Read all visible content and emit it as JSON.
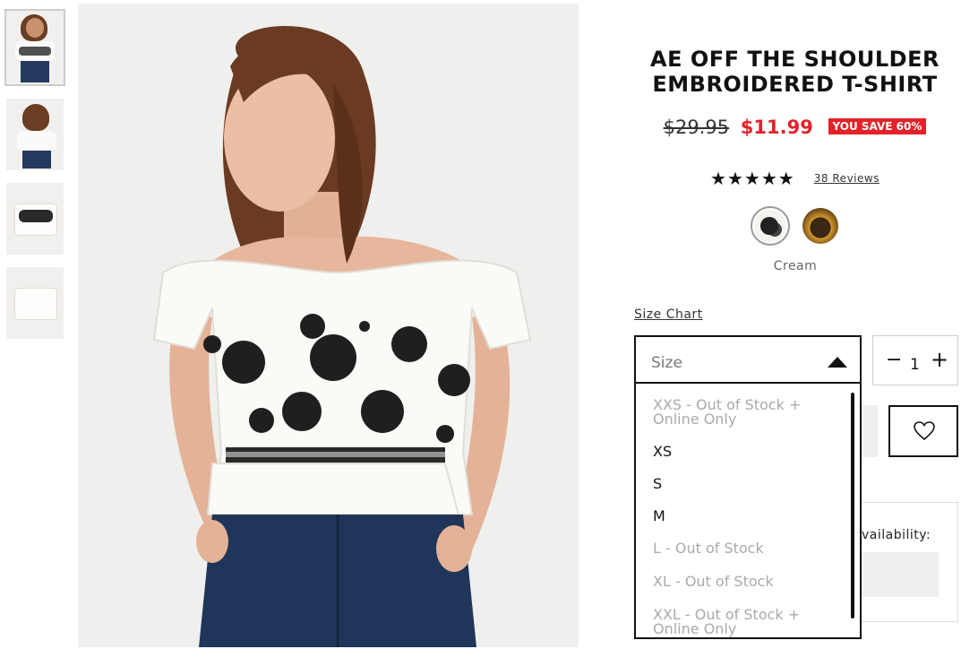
{
  "thumbnails": [
    {
      "label": "model front",
      "active": true
    },
    {
      "label": "model back",
      "active": false
    },
    {
      "label": "flat front",
      "active": false
    },
    {
      "label": "flat back",
      "active": false
    }
  ],
  "product": {
    "title_line1": "AE OFF THE SHOULDER",
    "title_line2": "EMBROIDERED T-SHIRT",
    "price_old": "$29.95",
    "price_new": "$11.99",
    "save_badge": "YOU SAVE 60%",
    "stars": "★★★★★",
    "rating": 5,
    "reviews": "38 Reviews",
    "color_name": "Cream"
  },
  "size": {
    "chart_link": "Size Chart",
    "placeholder": "Size",
    "options": [
      {
        "label": "XXS - Out of Stock + Online Only",
        "in_stock": false
      },
      {
        "label": "XS",
        "in_stock": true
      },
      {
        "label": "S",
        "in_stock": true
      },
      {
        "label": "M",
        "in_stock": true
      },
      {
        "label": "L - Out of Stock",
        "in_stock": false
      },
      {
        "label": "XL - Out of Stock",
        "in_stock": false
      },
      {
        "label": "XXL - Out of Stock + Online Only",
        "in_stock": false
      }
    ]
  },
  "quantity": {
    "minus": "−",
    "value": "1",
    "plus": "+"
  },
  "availability": {
    "label": "vailability:"
  },
  "colors": {
    "sale_red": "#e4222a",
    "text": "#111111"
  }
}
